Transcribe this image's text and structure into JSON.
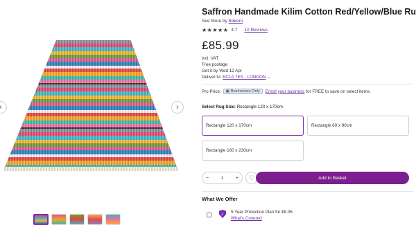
{
  "product": {
    "title": "Saffron Handmade Kilim Cotton Red/Yellow/Blue Rug",
    "see_more_prefix": "See More by",
    "brand": "Bakero",
    "stars": "★★★★★",
    "rating": "4.7",
    "reviews": "10 Reviews",
    "price": "£85.99"
  },
  "info": {
    "vat": "incl. VAT",
    "postage": "Free postage",
    "delivery_date": "Get it by Wed 12 Apr",
    "deliver_to_prefix": "Deliver to:",
    "deliver_location": "EC1A 7ES - LONDON"
  },
  "pro": {
    "label": "Pro Price:",
    "tag": "Businesses Only",
    "enroll": "Enroll your business",
    "rest": "for FREE to save on select items."
  },
  "size": {
    "label": "Select Rug Size:",
    "selected": "Rectangle 120 x 170cm",
    "options": [
      "Rectangle 120 x 170cm",
      "Rectangle 60 x 90cm",
      "Rectangle 160 x 230cm"
    ]
  },
  "cart": {
    "minus": "−",
    "qty": "1",
    "plus": "+",
    "heart": "♡",
    "add_to_basket": "Add to Basket"
  },
  "offer": {
    "header": "What We Offer",
    "plan": "5 Year Protection Plan for £8.06",
    "covered": "What's Covered"
  },
  "nav": {
    "prev": "‹",
    "next": "›"
  },
  "colors": {
    "accent": "#7b2bb5",
    "button": "#7b1f8f",
    "link": "#6b2ca0"
  },
  "icons": [
    "chevron-left-icon",
    "chevron-right-icon",
    "heart-icon",
    "shield-icon",
    "chevron-down-icon",
    "business-icon"
  ]
}
